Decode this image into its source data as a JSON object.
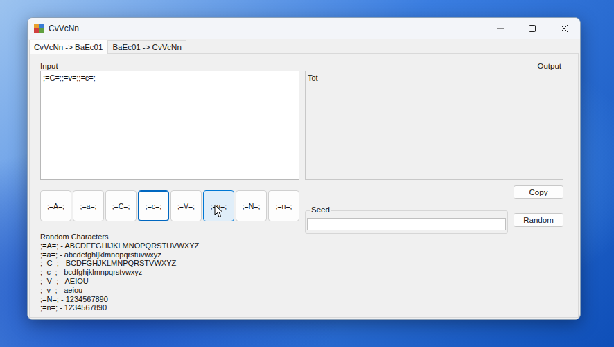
{
  "window": {
    "title": "CvVcNn"
  },
  "tabs": [
    {
      "label": "CvVcNn -> BaEc01",
      "selected": true
    },
    {
      "label": "BaEc01 -> CvVcNn",
      "selected": false
    }
  ],
  "input": {
    "label": "Input",
    "value": ";=C=;;=v=;;=c=;"
  },
  "output": {
    "label": "Output",
    "value": "Tot"
  },
  "insert_buttons": [
    {
      "label": ";=A=;",
      "focused": false,
      "hovered": false
    },
    {
      "label": ";=a=;",
      "focused": false,
      "hovered": false
    },
    {
      "label": ";=C=;",
      "focused": false,
      "hovered": false
    },
    {
      "label": ";=c=;",
      "focused": true,
      "hovered": false
    },
    {
      "label": ";=V=;",
      "focused": false,
      "hovered": false
    },
    {
      "label": ";=v=;",
      "focused": false,
      "hovered": true
    },
    {
      "label": ";=N=;",
      "focused": false,
      "hovered": false
    },
    {
      "label": ";=n=;",
      "focused": false,
      "hovered": false
    }
  ],
  "copy_button": "Copy",
  "seed": {
    "label": "Seed",
    "value": ""
  },
  "random_button": "Random",
  "random_characters": {
    "title": "Random Characters",
    "lines": [
      ";=A=; - ABCDEFGHIJKLMNOPQRSTUVWXYZ",
      ";=a=; - abcdefghijklmnopqrstuvwxyz",
      ";=C=; - BCDFGHJKLMNPQRSTVWXYZ",
      ";=c=; - bcdfghjklmnpqrstvwxyz",
      ";=V=; - AEIOU",
      ";=v=; - aeiou",
      ";=N=; - 1234567890",
      ";=n=; - 1234567890"
    ]
  }
}
